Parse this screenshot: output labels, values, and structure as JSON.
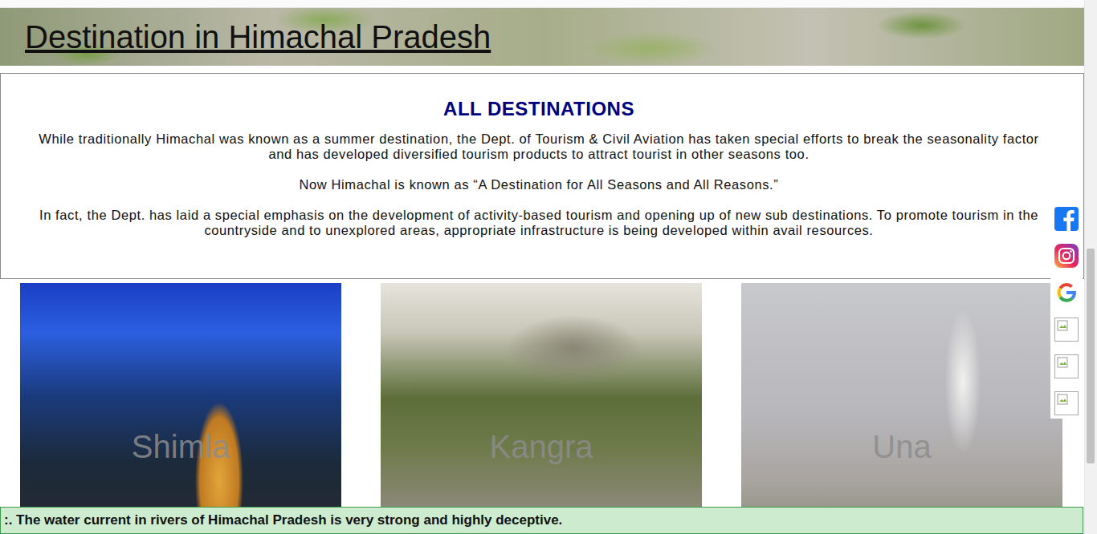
{
  "page": {
    "title": "Destination in Himachal Pradesh"
  },
  "intro": {
    "heading": "ALL DESTINATIONS",
    "paragraphs": [
      "While traditionally Himachal was known as a summer destination, the Dept. of Tourism & Civil Aviation has taken special efforts to break the seasonality factor and has developed diversified tourism products to attract tourist in other seasons too.",
      "Now Himachal is known as “A Destination for All Seasons and All Reasons.”",
      "In fact, the Dept. has laid a special emphasis on the development of activity-based tourism and opening up of new sub destinations. To promote tourism in the countryside and to unexplored areas, appropriate infrastructure is being developed within avail resources."
    ]
  },
  "destinations": [
    {
      "name": "Shimla",
      "kind": "shimla"
    },
    {
      "name": "Kangra",
      "kind": "kangra"
    },
    {
      "name": "Una",
      "kind": "una"
    }
  ],
  "social": [
    {
      "kind": "facebook"
    },
    {
      "kind": "instagram"
    },
    {
      "kind": "google"
    },
    {
      "kind": "broken"
    },
    {
      "kind": "broken"
    },
    {
      "kind": "broken"
    }
  ],
  "ticker": {
    "text": ":. The water current in rivers of Himachal Pradesh is very strong and highly deceptive."
  }
}
